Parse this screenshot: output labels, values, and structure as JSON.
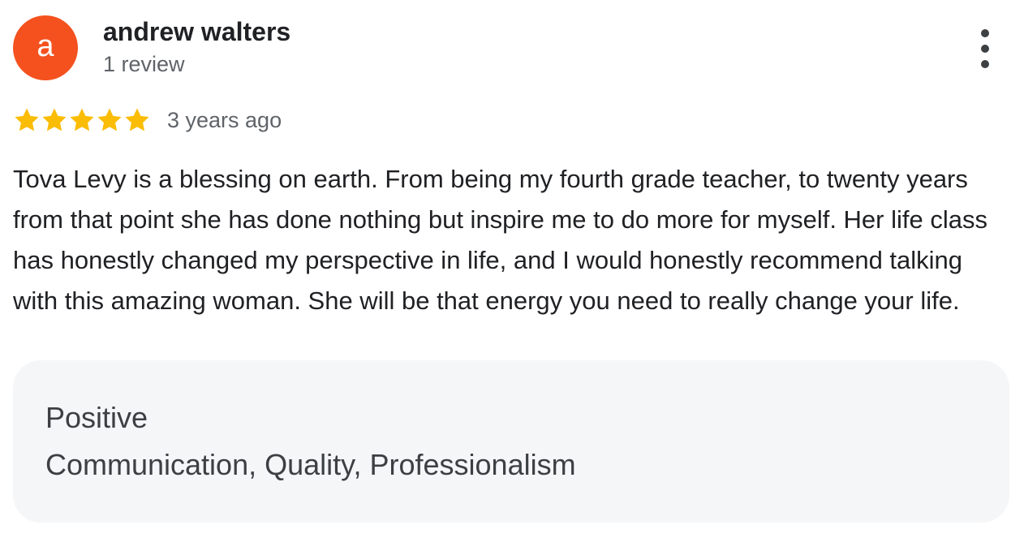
{
  "reviewer": {
    "avatar_letter": "a",
    "name": "andrew walters",
    "review_count": "1 review"
  },
  "rating": {
    "stars": 5,
    "max_stars": 5,
    "star_color": "#fbbc04",
    "date": "3 years ago"
  },
  "review": {
    "text": "Tova Levy is a blessing on earth. From being my fourth grade teacher, to twenty years from that point she has done nothing but inspire me to do more for myself. Her life class has honestly changed my perspective in life, and I would honestly recommend talking with this amazing woman. She will be that energy you need to really change your life."
  },
  "attributes": {
    "title": "Positive",
    "values": "Communication, Quality, Professionalism"
  },
  "colors": {
    "avatar_background": "#f4511e",
    "attributes_background": "#f5f6f8"
  },
  "icons": {
    "more": "more-vert-icon",
    "star": "star-icon"
  }
}
